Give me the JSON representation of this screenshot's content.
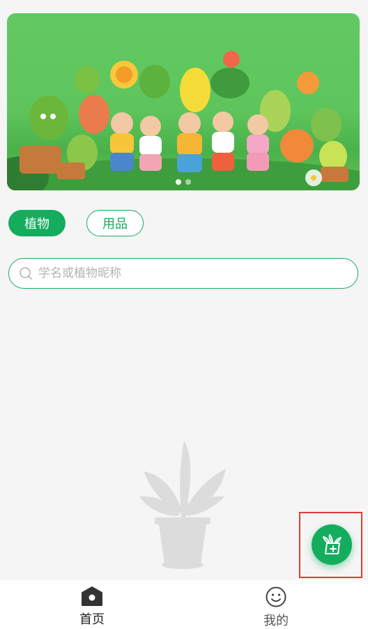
{
  "banner": {
    "slides": 2,
    "active_slide": 1
  },
  "category_tabs": [
    {
      "label": "植物",
      "active": true
    },
    {
      "label": "用品",
      "active": false
    }
  ],
  "search": {
    "placeholder": "学名或植物昵称",
    "value": ""
  },
  "fab": {
    "icon": "add-plant-icon"
  },
  "tabbar": [
    {
      "label": "首页",
      "icon": "home-icon",
      "active": true
    },
    {
      "label": "我的",
      "icon": "smiley-icon",
      "active": false
    }
  ],
  "colors": {
    "accent": "#14ad5e",
    "highlight": "#e53935"
  }
}
